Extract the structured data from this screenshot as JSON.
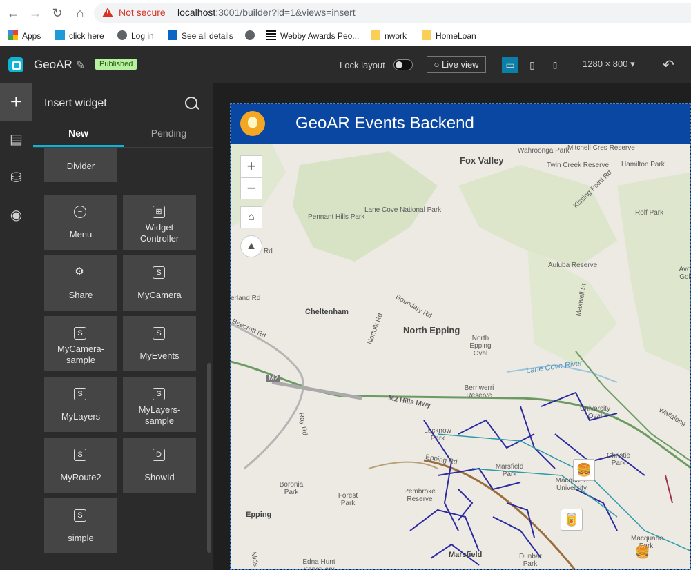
{
  "browser": {
    "security_label": "Not secure",
    "url_host": "localhost",
    "url_rest": ":3001/builder?id=1&views=insert",
    "bookmarks": [
      {
        "label": "Apps",
        "icon": "apps-grid-icon"
      },
      {
        "label": "click here",
        "icon": "site-favicon-icon"
      },
      {
        "label": "Log in",
        "icon": "globe-icon"
      },
      {
        "label": "See all details",
        "icon": "linkedin-icon"
      },
      {
        "label": "",
        "icon": "globe-icon"
      },
      {
        "label": "Webby Awards Peo...",
        "icon": "webby-icon"
      },
      {
        "label": "nwork",
        "icon": "folder-icon"
      },
      {
        "label": "HomeLoan",
        "icon": "folder-icon"
      }
    ]
  },
  "builder": {
    "app_name": "GeoAR",
    "status_badge": "Published",
    "lock_layout_label": "Lock layout",
    "live_view_label": "Live view",
    "resolution": "1280 × 800",
    "accent_color": "#0bb4d8"
  },
  "panel": {
    "title": "Insert widget",
    "tabs": [
      {
        "label": "New",
        "active": true
      },
      {
        "label": "Pending",
        "active": false
      }
    ],
    "widgets": [
      {
        "label": "Divider",
        "icon": "divider-icon"
      },
      {
        "label": "Menu",
        "icon": "menu-icon"
      },
      {
        "label": "Widget Controller",
        "icon": "widget-controller-icon"
      },
      {
        "label": "Share",
        "icon": "share-icon"
      },
      {
        "label": "MyCamera",
        "icon": "S"
      },
      {
        "label": "MyCamera-sample",
        "icon": "S"
      },
      {
        "label": "MyEvents",
        "icon": "S"
      },
      {
        "label": "MyLayers",
        "icon": "S"
      },
      {
        "label": "MyLayers-sample",
        "icon": "S"
      },
      {
        "label": "MyRoute2",
        "icon": "S"
      },
      {
        "label": "ShowId",
        "icon": "D"
      },
      {
        "label": "simple",
        "icon": "S"
      }
    ]
  },
  "app": {
    "title": "GeoAR Events Backend",
    "header_color": "#0a47a3"
  },
  "map": {
    "labels": [
      "Fox Valley",
      "Wahroonga Park",
      "Mitchell Cres Reserve",
      "Twin Creek Reserve",
      "Kissing Point Rd",
      "Hamilton Park",
      "Pennant Hills Park",
      "Lane Cove National Park",
      "Rolf Park",
      "Auluba Reserve",
      "Maxwell St",
      "Boundary Rd",
      "Cheltenham",
      "North Epping",
      "Norfolk Rd",
      "North Epping Oval",
      "Lane Cove River",
      "Berriwerri Reserve",
      "M2 Hills Mwy",
      "M2",
      "Ray Rd",
      "Lucknow Park",
      "University Oval",
      "Wallalong",
      "Christie Park",
      "Marsfield Park",
      "Macquarie University",
      "Boronia Park",
      "Forest Park",
      "Pembroke Reserve",
      "Epping",
      "Marsfield",
      "Dunbar Park",
      "Edna Hunt Sanctuary",
      "Macquarie Park",
      "Epping Rd",
      "Avo Gol",
      "erland Rd",
      "Beecroft Rd",
      "Rd",
      "Mids"
    ]
  }
}
